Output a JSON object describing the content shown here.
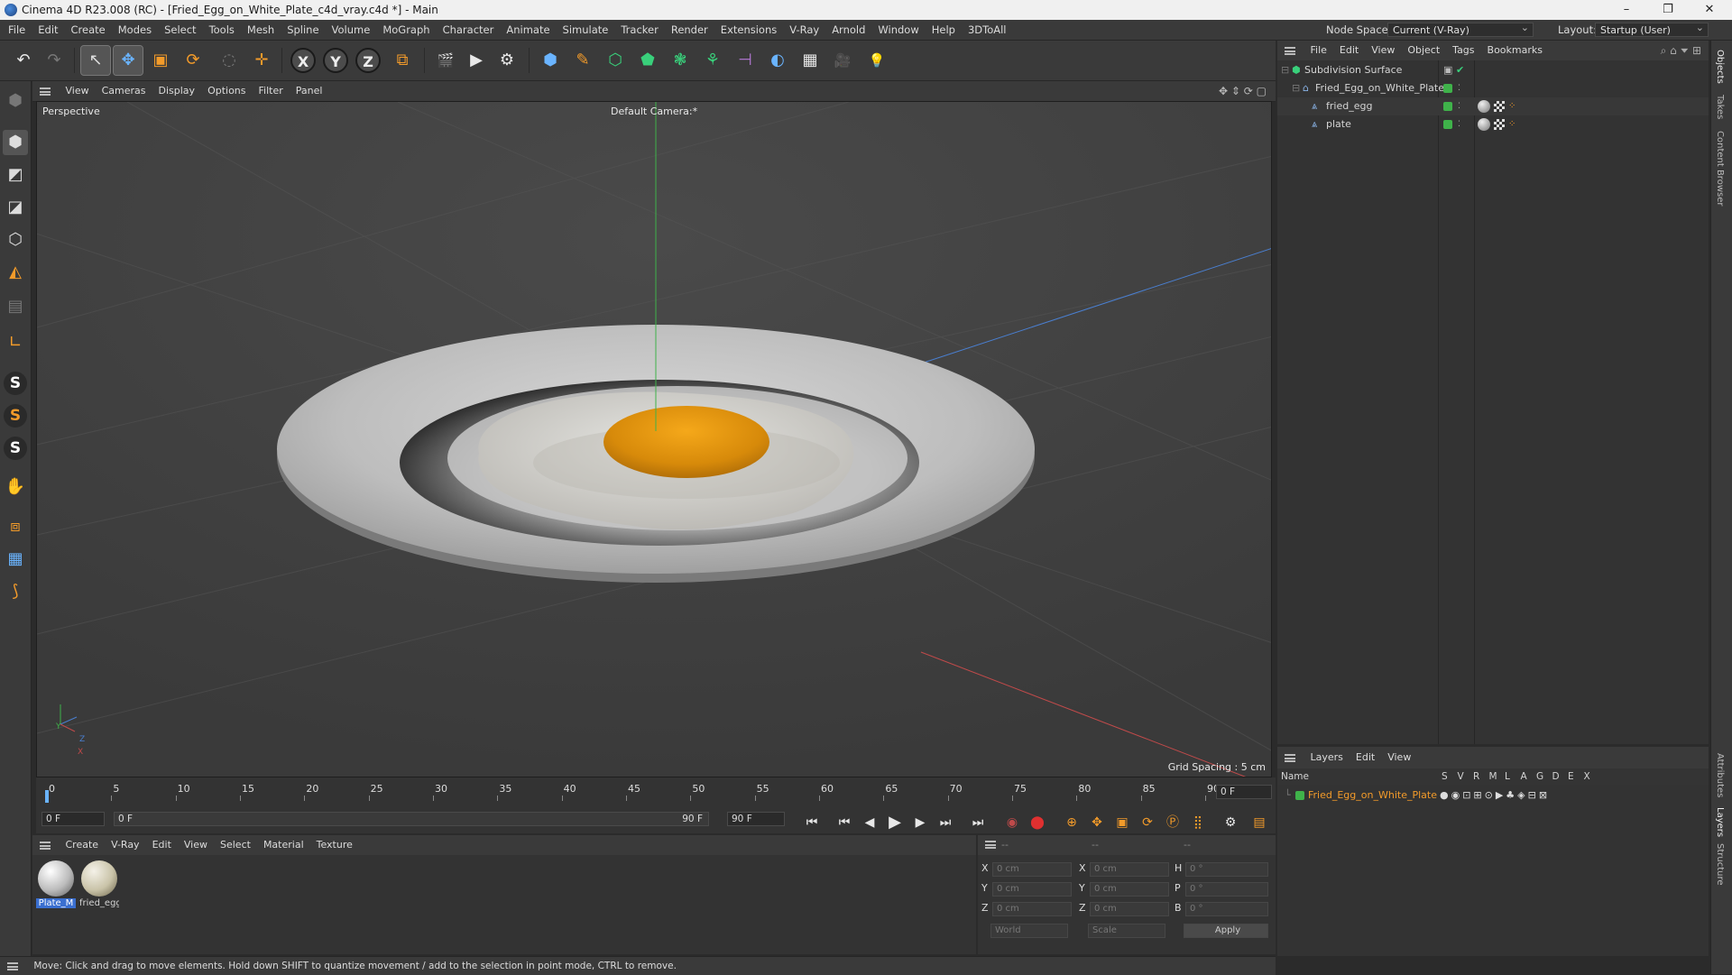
{
  "window": {
    "title": "Cinema 4D R23.008 (RC) - [Fried_Egg_on_White_Plate_c4d_vray.c4d *] - Main",
    "minimize": "–",
    "maximize": "❐",
    "close": "✕"
  },
  "menu": [
    "File",
    "Edit",
    "Create",
    "Modes",
    "Select",
    "Tools",
    "Mesh",
    "Spline",
    "Volume",
    "MoGraph",
    "Character",
    "Animate",
    "Simulate",
    "Tracker",
    "Render",
    "Extensions",
    "V-Ray",
    "Arnold",
    "Window",
    "Help",
    "3DToAll"
  ],
  "menu_right": {
    "node_space_label": "Node Space:",
    "node_space_value": "Current (V-Ray)",
    "layout_label": "Layout:",
    "layout_value": "Startup (User)"
  },
  "toolbar": {
    "undo": "↶",
    "redo": "↷",
    "select": "↖",
    "move": "✥",
    "scale": "▣",
    "rotate": "⟳",
    "live": "◌",
    "axis_move": "✛",
    "x": "X",
    "y": "Y",
    "z": "Z",
    "coord": "⧉",
    "render_region": "🎬",
    "render_view": "▶",
    "render_settings": "⚙",
    "cube": "⬢",
    "pen": "✎",
    "subdivision": "⬡",
    "extrude": "⬟",
    "cloner": "❃",
    "array": "⚘",
    "deformer": "⊣",
    "field": "◐",
    "floor": "▦",
    "camera": "🎥",
    "light": "💡"
  },
  "left_tools": [
    "⬢",
    "◩",
    "◪",
    "⬡",
    "◭",
    "▤",
    "∟",
    "S",
    "S",
    "S",
    "✋",
    "⧈",
    "▦",
    "⟆"
  ],
  "viewport": {
    "menu": [
      "View",
      "Cameras",
      "Display",
      "Options",
      "Filter",
      "Panel"
    ],
    "label": "Perspective",
    "camera": "Default Camera",
    "camera_suffix": ":*",
    "grid_spacing": "Grid Spacing : 5 cm",
    "axis_y": "Y",
    "axis_z": "Z",
    "axis_x": "X"
  },
  "timeline": {
    "ticks": [
      "0",
      "5",
      "10",
      "15",
      "20",
      "25",
      "30",
      "35",
      "40",
      "45",
      "50",
      "55",
      "60",
      "65",
      "70",
      "75",
      "80",
      "85",
      "90"
    ],
    "current_frame": "0 F",
    "start_field": "0 F",
    "range_start": "0 F",
    "range_end": "90 F",
    "end_field": "90 F"
  },
  "materials": {
    "menu": [
      "Create",
      "V-Ray",
      "Edit",
      "View",
      "Select",
      "Material",
      "Texture"
    ],
    "items": [
      {
        "name": "Plate_M"
      },
      {
        "name": "fried_egg"
      }
    ]
  },
  "coords": {
    "header": [
      "--",
      "--",
      "--"
    ],
    "rows": [
      {
        "a": "X",
        "av": "0 cm",
        "b": "X",
        "bv": "0 cm",
        "c": "H",
        "cv": "0 °"
      },
      {
        "a": "Y",
        "av": "0 cm",
        "b": "Y",
        "bv": "0 cm",
        "c": "P",
        "cv": "0 °"
      },
      {
        "a": "Z",
        "av": "0 cm",
        "b": "Z",
        "bv": "0 cm",
        "c": "B",
        "cv": "0 °"
      }
    ],
    "space": "World",
    "mode": "Scale",
    "apply": "Apply"
  },
  "status": "Move: Click and drag to move elements. Hold down SHIFT to quantize movement / add to the selection in point mode, CTRL to remove.",
  "objects": {
    "menu": [
      "File",
      "Edit",
      "View",
      "Object",
      "Tags",
      "Bookmarks"
    ],
    "rows": [
      {
        "name": "Subdivision Surface"
      },
      {
        "name": "Fried_Egg_on_White_Plate"
      },
      {
        "name": "fried_egg"
      },
      {
        "name": "plate"
      }
    ]
  },
  "layers": {
    "menu": [
      "Layers",
      "Edit",
      "View"
    ],
    "col_name": "Name",
    "cols": [
      "S",
      "V",
      "R",
      "M",
      "L",
      "A",
      "G",
      "D",
      "E",
      "X"
    ],
    "rows": [
      {
        "name": "Fried_Egg_on_White_Plate"
      }
    ]
  },
  "right_tabs": [
    "Objects",
    "Takes",
    "Content Browser",
    "Attributes",
    "Layers",
    "Structure"
  ],
  "colors": {
    "accent_orange": "#f39b2a",
    "layer_green": "#3fb24a",
    "yolk": "#e39a0e",
    "axis_x": "#c04a4a",
    "axis_y": "#3fb24a",
    "axis_z": "#4a7fd0"
  }
}
